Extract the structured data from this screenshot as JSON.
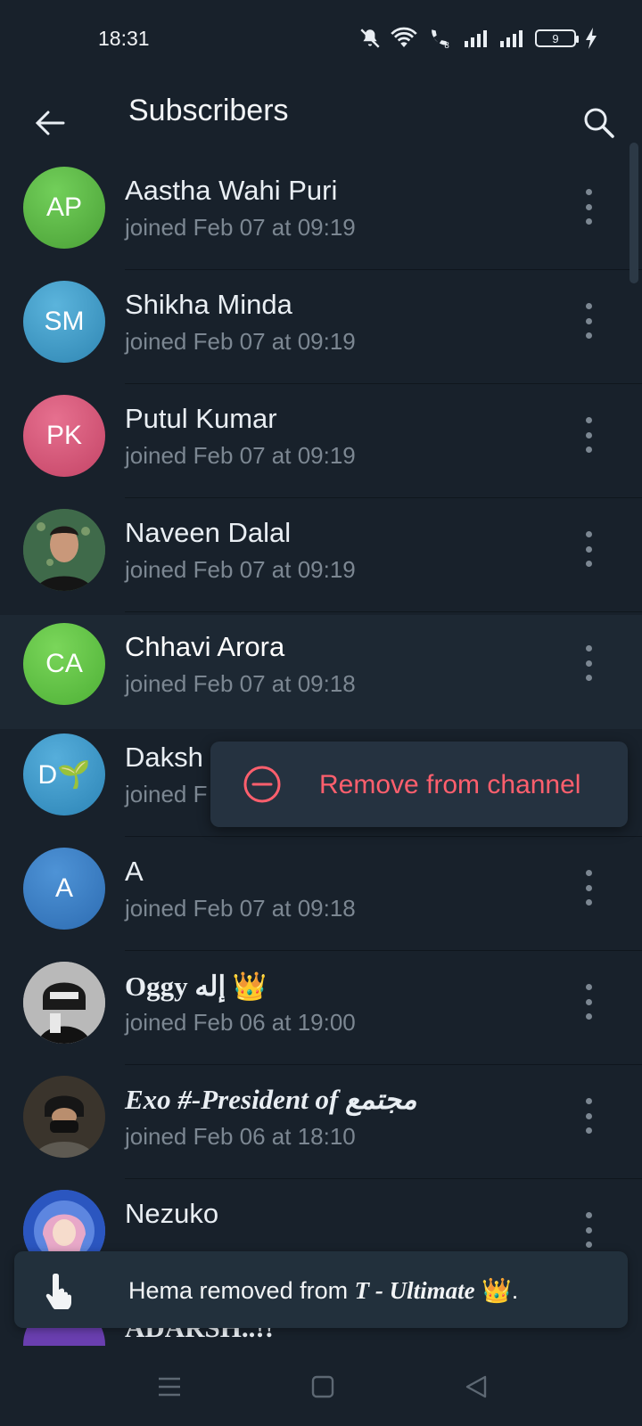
{
  "status_bar": {
    "time": "18:31",
    "battery": "9",
    "icons": [
      "mute-icon",
      "wifi-icon",
      "volte-call-icon",
      "signal-icon",
      "signal-icon",
      "battery-icon",
      "charging-icon"
    ]
  },
  "app_bar": {
    "title": "Subscribers",
    "back_icon": "back-arrow-icon",
    "search_icon": "search-icon"
  },
  "subscribers": [
    {
      "name": "Aastha Wahi Puri",
      "status": "joined Feb 07 at 09:19",
      "initials": "AP",
      "color": "#5dbb46"
    },
    {
      "name": "Shikha Minda",
      "status": "joined Feb 07 at 09:19",
      "initials": "SM",
      "color": "#3e9ec9"
    },
    {
      "name": "Putul Kumar",
      "status": "joined Feb 07 at 09:19",
      "initials": "PK",
      "color": "#d6587a"
    },
    {
      "name": "Naveen Dalal",
      "status": "joined Feb 07 at 09:19",
      "initials": "",
      "color": "#3e4a3a"
    },
    {
      "name": "Chhavi Arora",
      "status": "joined Feb 07 at 09:18",
      "initials": "CA",
      "color": "#63c640"
    },
    {
      "name": "Daksh",
      "status": "joined F",
      "initials": "D🌱",
      "color": "#3c95c4"
    },
    {
      "name": "A",
      "status": "joined Feb 07 at 09:18",
      "initials": "A",
      "color": "#3c7fc4"
    },
    {
      "name": "Oggy إله 👑",
      "status": "joined Feb 06 at 19:00",
      "initials": "",
      "color": "#8d8d8d"
    },
    {
      "name": "Exo #-President of مجتمع",
      "status": "joined Feb 06 at 18:10",
      "initials": "",
      "color": "#2e2a24"
    },
    {
      "name": "Nezuko",
      "status": "",
      "initials": "",
      "color": "#4a6fd0"
    },
    {
      "name": "ADARSH..!!",
      "status": "",
      "initials": "",
      "color": "#6a3fb0"
    }
  ],
  "context_menu": {
    "label": "Remove from channel",
    "icon": "remove-circle-icon",
    "color": "#ff5f6d"
  },
  "toast": {
    "name": "Hema",
    "text_middle": " removed from ",
    "channel": "T - Ultimate",
    "suffix": " 👑.",
    "icon": "hand-pointing-icon"
  },
  "nav_bar": {
    "menu_icon": "menu-icon",
    "home_icon": "home-square-icon",
    "back_icon": "back-triangle-icon"
  }
}
